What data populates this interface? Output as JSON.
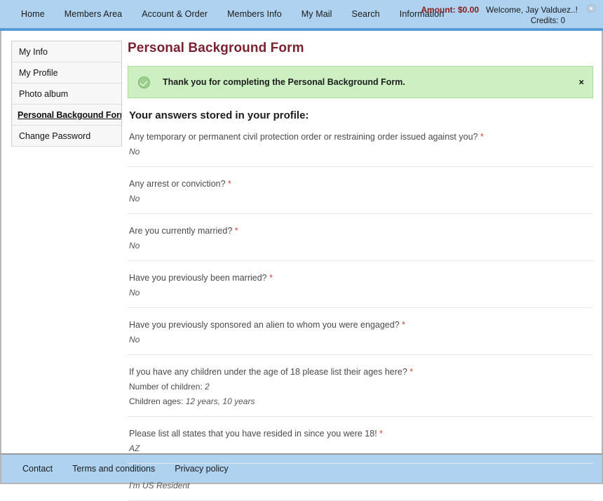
{
  "topnav": {
    "items": [
      {
        "label": "Home",
        "name": "nav-home"
      },
      {
        "label": "Members Area",
        "name": "nav-members-area"
      },
      {
        "label": "Account & Order",
        "name": "nav-account-order"
      },
      {
        "label": "Members Info",
        "name": "nav-members-info"
      },
      {
        "label": "My Mail",
        "name": "nav-my-mail"
      },
      {
        "label": "Search",
        "name": "nav-search"
      },
      {
        "label": "Information",
        "name": "nav-information"
      }
    ],
    "amount_label": "Amount: $0.00",
    "welcome_label": "Welcome, Jay Valduez..!",
    "credits_label": "Credits: 0",
    "gear_icon": "gear-icon",
    "amount_color": "#8a1a1a",
    "bar_color": "#aed2f0",
    "bar_border_color": "#5b9bd5"
  },
  "sidebar": {
    "items": [
      {
        "label": "My Info",
        "active": false
      },
      {
        "label": "My Profile",
        "active": false
      },
      {
        "label": "Photo album",
        "active": false
      },
      {
        "label": "Personal Backgound Form",
        "active": true
      },
      {
        "label": "Change Password",
        "active": false
      }
    ]
  },
  "main": {
    "page_title": "Personal Background Form",
    "page_title_color": "#7b2230",
    "alert": {
      "message": "Thank you for completing the Personal Background Form.",
      "close_label": "×",
      "icon": "check-circle-icon",
      "bg_color": "#ccf0c2",
      "border_color": "#a9dd9b"
    },
    "answers_heading": "Your answers stored in your profile:",
    "required_marker": "*",
    "required_marker_color": "#d0473e",
    "answers": [
      {
        "question": "Any temporary or permanent civil protection order or restraining order issued against you?",
        "required": true,
        "answer": "No"
      },
      {
        "question": "Any arrest or conviction?",
        "required": true,
        "answer": "No"
      },
      {
        "question": "Are you currently married?",
        "required": true,
        "answer": "No"
      },
      {
        "question": "Have you previously been married?",
        "required": true,
        "answer": "No"
      },
      {
        "question": "Have you previously sponsored an alien to whom you were engaged?",
        "required": true,
        "answer": "No"
      },
      {
        "question": "If you have any children under the age of 18 please list their ages here?",
        "required": true,
        "detail_lines": [
          {
            "label": "Number of children:",
            "value": "2"
          },
          {
            "label": "Children ages:",
            "value": "12 years, 10 years"
          }
        ]
      },
      {
        "question": "Please list all states that you have resided in since you were 18!",
        "required": true,
        "answer": "AZ"
      },
      {
        "question": "",
        "required": false,
        "answer": "I'm US Resident"
      }
    ]
  },
  "footer": {
    "links": [
      {
        "label": "Contact"
      },
      {
        "label": "Terms and conditions"
      },
      {
        "label": "Privacy policy"
      }
    ]
  }
}
